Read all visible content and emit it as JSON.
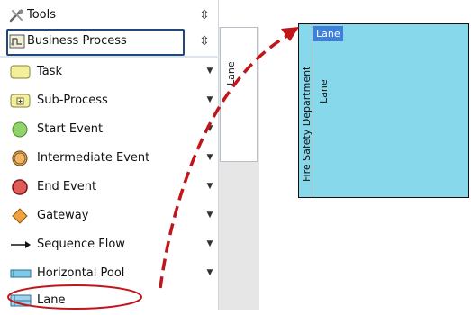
{
  "palette": {
    "tools_label": "Tools",
    "group_label": "Business Process",
    "items": [
      {
        "label": "Task",
        "icon": "task-icon"
      },
      {
        "label": "Sub-Process",
        "icon": "sub-process-icon"
      },
      {
        "label": "Start Event",
        "icon": "start-event-icon"
      },
      {
        "label": "Intermediate Event",
        "icon": "intermediate-event-icon"
      },
      {
        "label": "End Event",
        "icon": "end-event-icon"
      },
      {
        "label": "Gateway",
        "icon": "gateway-icon"
      },
      {
        "label": "Sequence Flow",
        "icon": "sequence-flow-icon"
      },
      {
        "label": "Horizontal Pool",
        "icon": "horizontal-pool-icon"
      },
      {
        "label": "Lane",
        "icon": "lane-icon"
      }
    ]
  },
  "strip": {
    "tab_label": "Lane"
  },
  "diagram": {
    "pool_name": "Fire Safety Department",
    "lane_tag": "Lane",
    "lane_label": "Lane"
  },
  "colors": {
    "highlight_frame": "#20477e",
    "annotation_red": "#c0151b",
    "pool_fill": "#86d8ea",
    "lane_tag_bg": "#3f7fd8"
  }
}
